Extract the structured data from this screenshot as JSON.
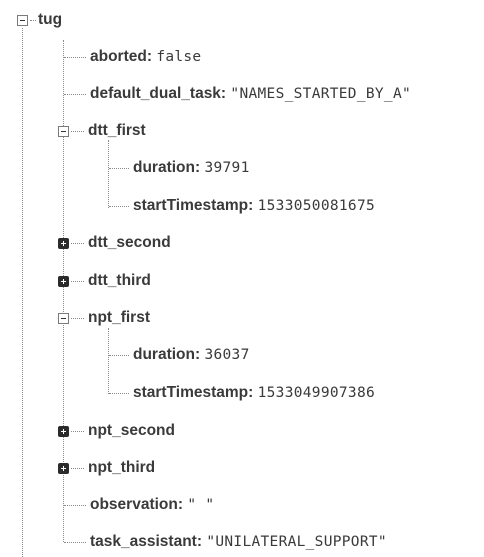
{
  "tree": {
    "root": {
      "key": "tug"
    },
    "aborted": {
      "key": "aborted:",
      "value": "false"
    },
    "default_dual_task": {
      "key": "default_dual_task:",
      "value": "\"NAMES_STARTED_BY_A\""
    },
    "dtt_first": {
      "key": "dtt_first",
      "duration": {
        "key": "duration:",
        "value": "39791"
      },
      "startTimestamp": {
        "key": "startTimestamp:",
        "value": "1533050081675"
      }
    },
    "dtt_second": {
      "key": "dtt_second"
    },
    "dtt_third": {
      "key": "dtt_third"
    },
    "npt_first": {
      "key": "npt_first",
      "duration": {
        "key": "duration:",
        "value": "36037"
      },
      "startTimestamp": {
        "key": "startTimestamp:",
        "value": "1533049907386"
      }
    },
    "npt_second": {
      "key": "npt_second"
    },
    "npt_third": {
      "key": "npt_third"
    },
    "observation": {
      "key": "observation:",
      "value": "\" \""
    },
    "task_assistant": {
      "key": "task_assistant:",
      "value": "\"UNILATERAL_SUPPORT\""
    }
  }
}
